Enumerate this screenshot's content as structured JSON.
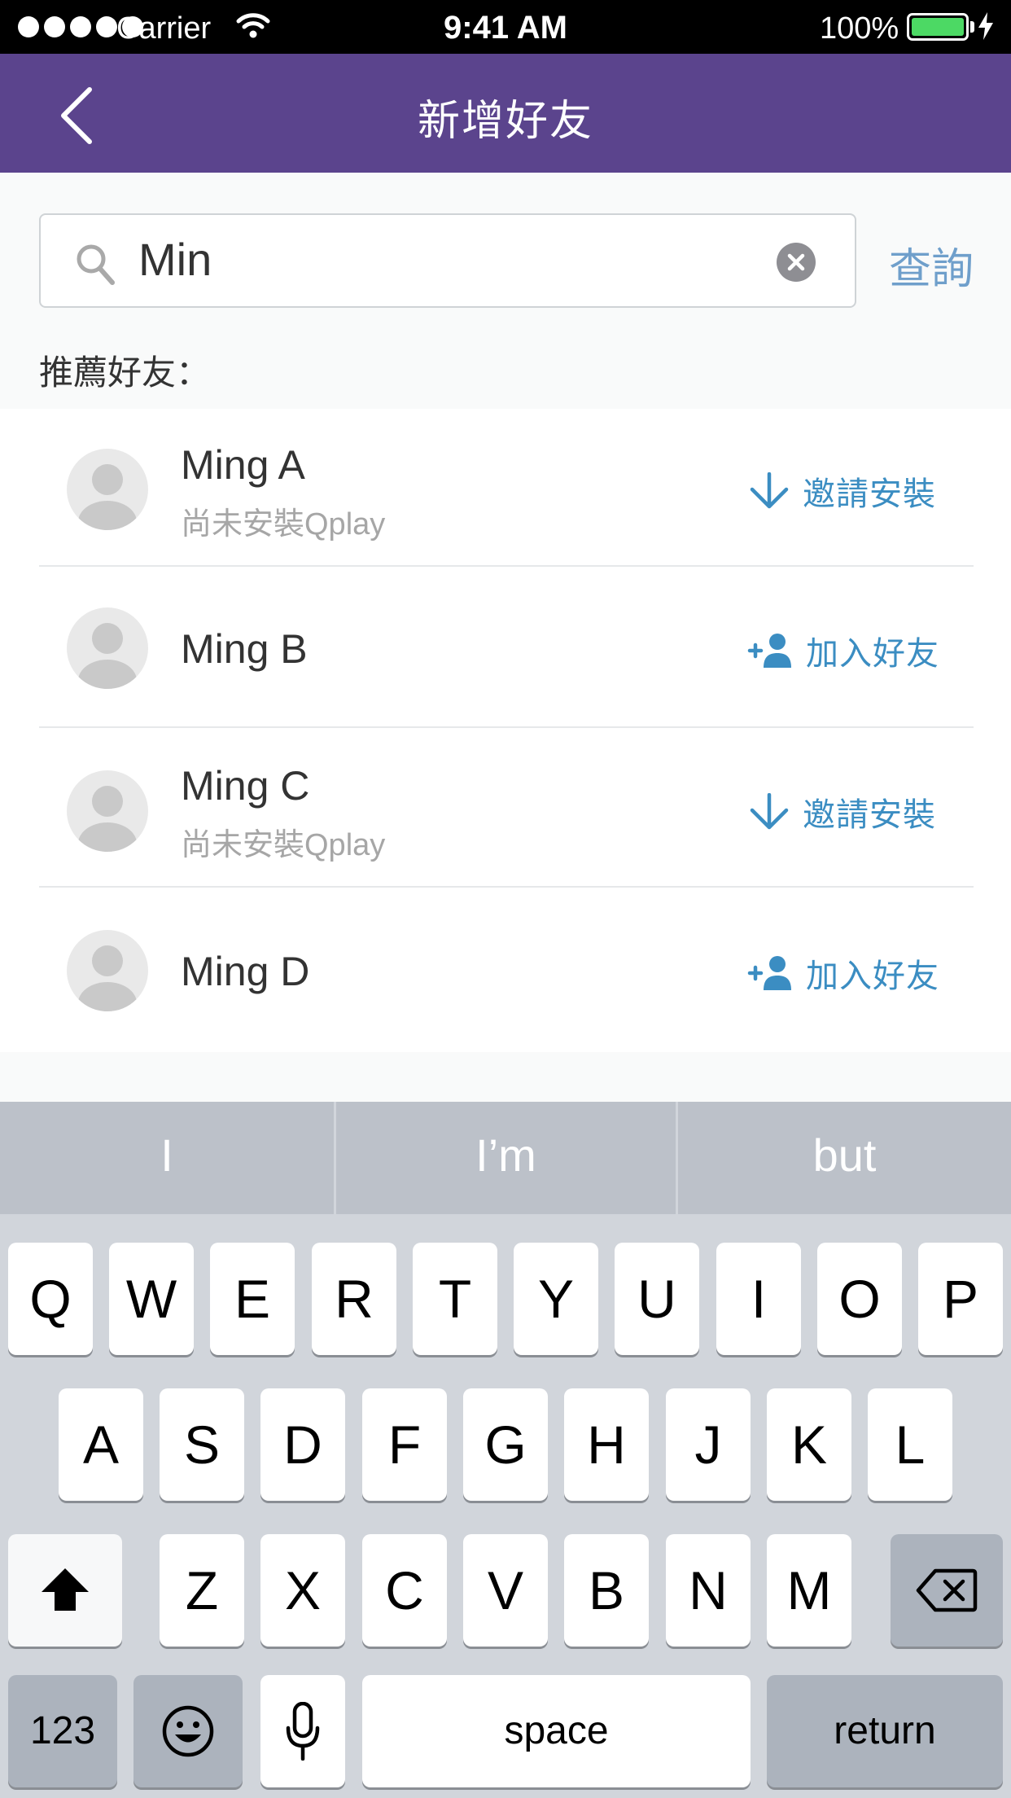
{
  "status_bar": {
    "carrier": "Carrier",
    "time": "9:41 AM",
    "battery": "100%",
    "battery_color": "#4cd964"
  },
  "nav": {
    "title": "新增好友"
  },
  "search": {
    "query": "Min",
    "button_label": "查詢"
  },
  "section_label": "推薦好友：",
  "friends": [
    {
      "name": "Ming A",
      "status": "尚未安裝Qplay",
      "action": "邀請安裝",
      "action_icon": "download-arrow-icon"
    },
    {
      "name": "Ming B",
      "status": "",
      "action": "加入好友",
      "action_icon": "add-person-icon"
    },
    {
      "name": "Ming C",
      "status": "尚未安裝Qplay",
      "action": "邀請安裝",
      "action_icon": "download-arrow-icon"
    },
    {
      "name": "Ming D",
      "status": "",
      "action": "加入好友",
      "action_icon": "add-person-icon"
    }
  ],
  "keyboard": {
    "suggestions": [
      "I",
      "I’m",
      "but"
    ],
    "row1": [
      "Q",
      "W",
      "E",
      "R",
      "T",
      "Y",
      "U",
      "I",
      "O",
      "P"
    ],
    "row2": [
      "A",
      "S",
      "D",
      "F",
      "G",
      "H",
      "J",
      "K",
      "L"
    ],
    "row3": [
      "Z",
      "X",
      "C",
      "V",
      "B",
      "N",
      "M"
    ],
    "numbers_key": "123",
    "space_key": "space",
    "return_key": "return"
  },
  "colors": {
    "nav_bg": "#5b448d",
    "accent": "#3b8dc2",
    "search_button": "#6f9fcb"
  }
}
